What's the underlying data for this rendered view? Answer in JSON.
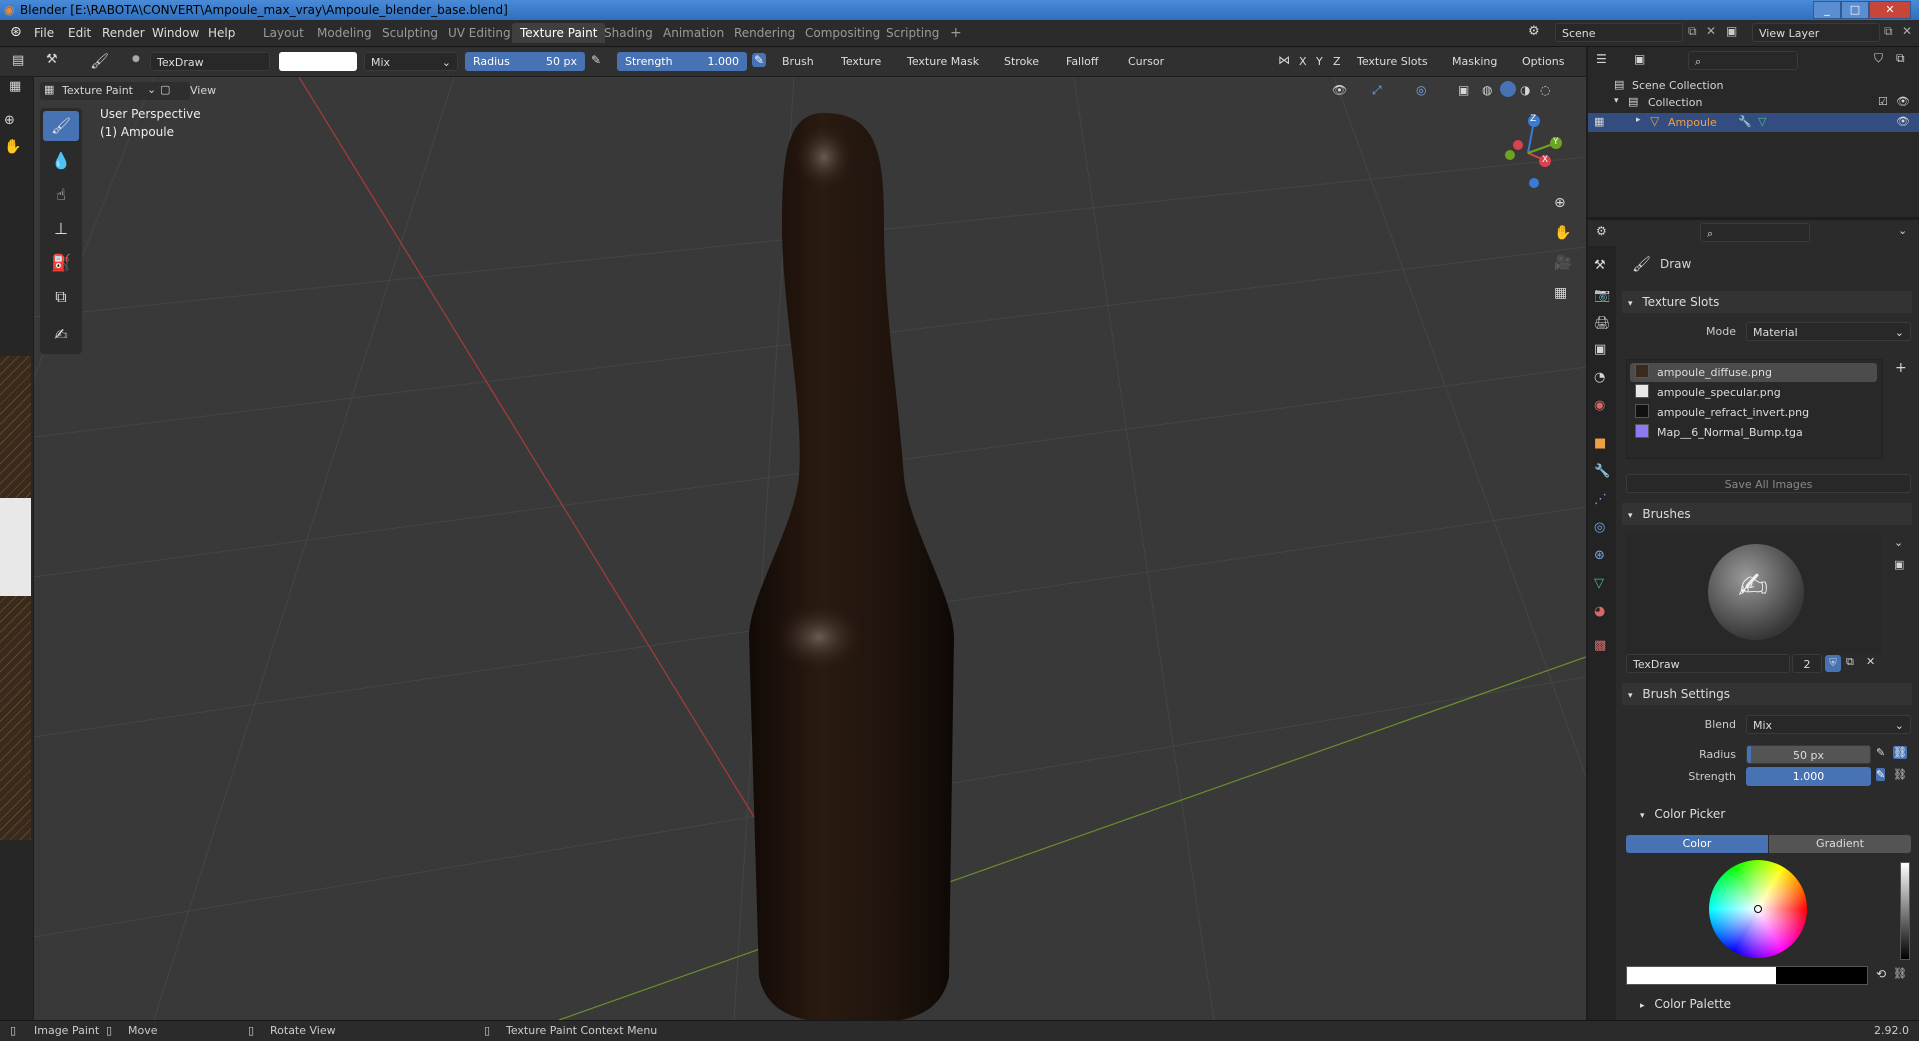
{
  "window": {
    "title": "Blender [E:\\RABOTA\\CONVERT\\Ampoule_max_vray\\Ampoule_blender_base.blend]",
    "min": "_",
    "max": "□",
    "close": "✕"
  },
  "menus": [
    "File",
    "Edit",
    "Render",
    "Window",
    "Help"
  ],
  "workspaces": [
    "Layout",
    "Modeling",
    "Sculpting",
    "UV Editing",
    "Texture Paint",
    "Shading",
    "Animation",
    "Rendering",
    "Compositing",
    "Scripting",
    "+"
  ],
  "scene": {
    "label": "Scene",
    "view_layer": "View Layer"
  },
  "toolheader": {
    "brush_name": "TexDraw",
    "blend": "Mix",
    "radius_label": "Radius",
    "radius_value": "50 px",
    "strength_label": "Strength",
    "strength_value": "1.000",
    "dropdowns": [
      "Brush",
      "Texture",
      "Texture Mask",
      "Stroke",
      "Falloff",
      "Cursor"
    ],
    "axes": [
      "X",
      "Y",
      "Z"
    ],
    "right_dropdowns": [
      "Texture Slots",
      "Masking",
      "Options"
    ]
  },
  "viewport_header": {
    "mode": "Texture Paint",
    "view": "View"
  },
  "viewport": {
    "perspective": "User Perspective",
    "object": "(1) Ampoule"
  },
  "gizmo": {
    "x": "X",
    "y": "Y",
    "z": "Z"
  },
  "outliner": {
    "scene_collection": "Scene Collection",
    "collection": "Collection",
    "object": "Ampoule"
  },
  "properties": {
    "tool": "Draw",
    "texture_slots": {
      "title": "Texture Slots",
      "mode_label": "Mode",
      "mode_value": "Material",
      "slots": [
        {
          "name": "ampoule_diffuse.png",
          "color": "#3a2a1c"
        },
        {
          "name": "ampoule_specular.png",
          "color": "#e8e8e8"
        },
        {
          "name": "ampoule_refract_invert.png",
          "color": "#111111"
        },
        {
          "name": "Map__6_Normal_Bump.tga",
          "color": "#8a7cf0"
        }
      ],
      "save_all": "Save All Images"
    },
    "brushes": {
      "title": "Brushes",
      "brush_name": "TexDraw",
      "users": "2"
    },
    "brush_settings": {
      "title": "Brush Settings",
      "blend_label": "Blend",
      "blend_value": "Mix",
      "radius_label": "Radius",
      "radius_value": "50 px",
      "strength_label": "Strength",
      "strength_value": "1.000"
    },
    "color_picker": {
      "title": "Color Picker",
      "tab_color": "Color",
      "tab_gradient": "Gradient"
    },
    "color_palette": {
      "title": "Color Palette"
    }
  },
  "statusbar": {
    "image_paint": "Image Paint",
    "move": "Move",
    "rotate": "Rotate View",
    "context": "Texture Paint Context Menu",
    "version": "2.92.0"
  }
}
